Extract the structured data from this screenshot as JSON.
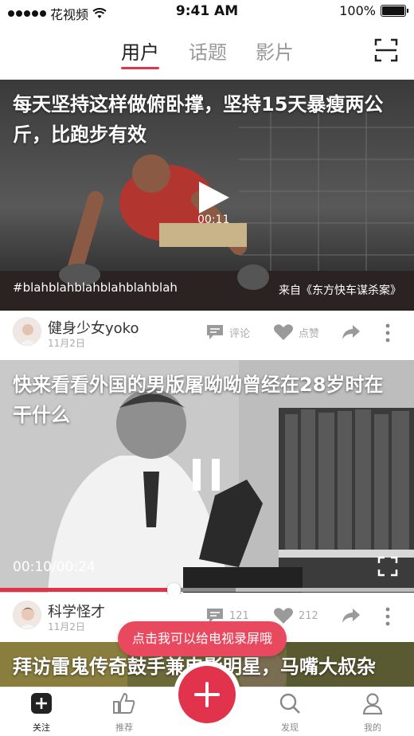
{
  "status_bar": {
    "carrier": "花视频",
    "time": "9:41 AM",
    "battery": "100%"
  },
  "top_tabs": [
    {
      "label": "用户",
      "active": true
    },
    {
      "label": "话题",
      "active": false
    },
    {
      "label": "影片",
      "active": false
    }
  ],
  "videos": [
    {
      "title": "每天坚持这样做俯卧撑，坚持15天暴瘦两公斤，比跑步有效",
      "duration": "00:11",
      "hashtag": "#blahblahblahblahblahblah",
      "source": "来自《东方快车谋杀案》",
      "author": "健身少女yoko",
      "date": "11月2日",
      "comment_label": "评论",
      "like_label": "点赞"
    },
    {
      "title": "快来看看外国的男版屠呦呦曾经在28岁时在干什么",
      "time_display": "00:10/00:24",
      "progress": 0.42,
      "buffered": 0.57,
      "author": "科学怪才",
      "date": "11月2日",
      "comment_count": "121",
      "like_count": "212"
    },
    {
      "title": "拜访雷鬼传奇鼓手兼电影明星，马嘴大叔杂"
    }
  ],
  "toast": "点击我可以给电视录屏哦",
  "bottom_nav": [
    {
      "label": "关注",
      "icon": "plus-square-icon",
      "active": true
    },
    {
      "label": "推荐",
      "icon": "thumbs-up-icon",
      "active": false
    },
    {
      "label": "发现",
      "icon": "search-icon",
      "active": false
    },
    {
      "label": "我的",
      "icon": "person-icon",
      "active": false
    }
  ],
  "colors": {
    "accent": "#e2334c",
    "toast": "#e8495f"
  }
}
